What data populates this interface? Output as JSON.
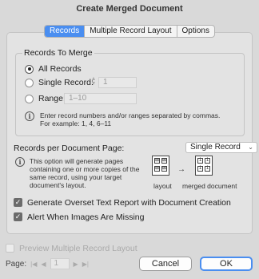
{
  "window": {
    "title": "Create Merged Document"
  },
  "tabs": [
    {
      "label": "Records",
      "active": true
    },
    {
      "label": "Multiple Record Layout",
      "active": false
    },
    {
      "label": "Options",
      "active": false
    }
  ],
  "records_group": {
    "title": "Records To Merge",
    "all_records": {
      "label": "All Records",
      "checked": true
    },
    "single_record": {
      "label": "Single Record:",
      "value": "1"
    },
    "range": {
      "label": "Range:",
      "placeholder": "1–10"
    },
    "note": "Enter record numbers and/or ranges separated by commas. For example: 1, 4, 6–11"
  },
  "per_page": {
    "label": "Records per Document Page:",
    "selected": "Single Record",
    "note": "This option will generate pages containing one or more copies of the same record, using your target document's layout.",
    "layout_caption": "layout",
    "merged_caption": "merged document"
  },
  "options": {
    "overset": {
      "label": "Generate Overset Text Report with Document Creation",
      "checked": true
    },
    "missing_images": {
      "label": "Alert When Images Are Missing",
      "checked": true
    },
    "preview": {
      "label": "Preview Multiple Record Layout",
      "checked": false,
      "enabled": false
    }
  },
  "pager": {
    "label": "Page:",
    "value": "1"
  },
  "buttons": {
    "cancel": "Cancel",
    "ok": "OK"
  },
  "colors": {
    "accent": "#4a8ef0",
    "background": "#d9d9d9"
  }
}
